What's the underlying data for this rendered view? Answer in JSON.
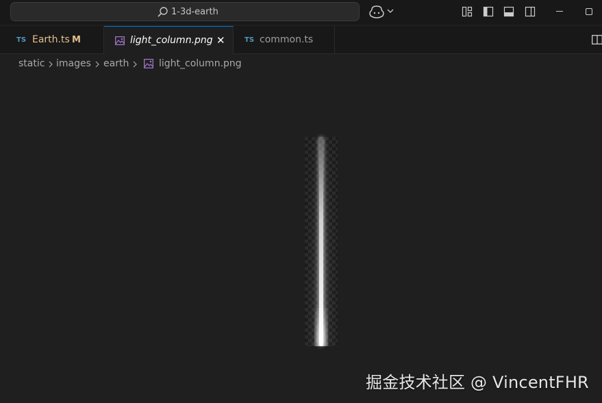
{
  "command_center": {
    "text": "1-3d-earth"
  },
  "tabs": [
    {
      "badge": "TS",
      "label": "Earth.ts",
      "status": "M",
      "label_color": "#e2c08d"
    },
    {
      "label": "light_column.png",
      "close": "✕"
    },
    {
      "badge": "TS",
      "label": "common.ts"
    }
  ],
  "breadcrumb": {
    "parts": [
      "static",
      "images",
      "earth",
      "light_column.png"
    ]
  },
  "editor": {
    "preview_file": "light_column.png"
  },
  "watermark": {
    "text": "掘金技术社区 @ VincentFHR"
  },
  "colors": {
    "accent": "#0078d4",
    "ts_badge": "#519aba",
    "modified": "#e2c08d",
    "image_icon": "#a074c4"
  },
  "icons": {
    "command_center": "search-icon",
    "copilot": "copilot-icon",
    "layout": [
      "customize-layout-icon",
      "toggle-primary-sidebar-icon",
      "toggle-panel-icon",
      "toggle-secondary-sidebar-icon"
    ],
    "window": [
      "minimize-icon",
      "maximize-icon"
    ],
    "tab_image": "image-file-icon",
    "split": "split-editor-icon"
  }
}
